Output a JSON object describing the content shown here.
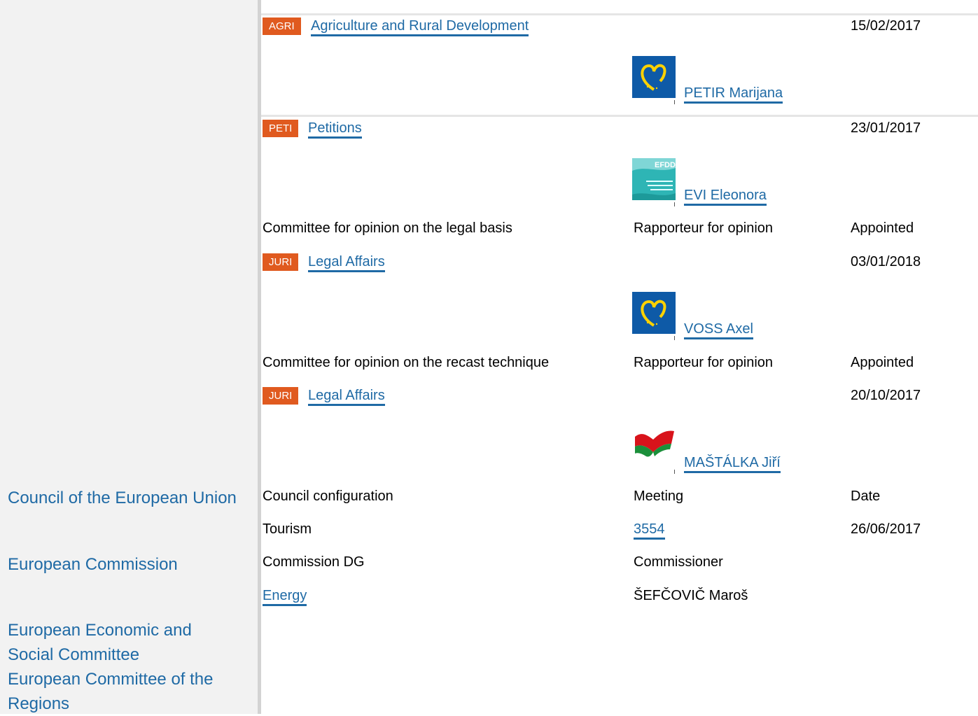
{
  "institutions": {
    "council": "Council of the European Union",
    "commission": "European Commission",
    "eesc": "European Economic and Social Committee",
    "cor": "European Committee of the Regions"
  },
  "committees": [
    {
      "code": "AGRI",
      "name": "Agriculture and Rural Development",
      "date": "15/02/2017",
      "rapporteur": "PETIR Marijana",
      "group_logo": "epp-heart-logo"
    },
    {
      "code": "PETI",
      "name": "Petitions",
      "date": "23/01/2017",
      "rapporteur": "EVI Eleonora",
      "group_logo": "efdd-logo"
    }
  ],
  "legal_basis": {
    "header": {
      "committee": "Committee for opinion on the legal basis",
      "role": "Rapporteur for opinion",
      "status": "Appointed"
    },
    "code": "JURI",
    "name": "Legal Affairs",
    "date": "03/01/2018",
    "rapporteur": "VOSS Axel",
    "group_logo": "epp-heart-logo"
  },
  "recast": {
    "header": {
      "committee": "Committee for opinion on the recast technique",
      "role": "Rapporteur for opinion",
      "status": "Appointed"
    },
    "code": "JURI",
    "name": "Legal Affairs",
    "date": "20/10/2017",
    "rapporteur": "MAŠTÁLKA Jiří",
    "group_logo": "gue-ngl-flag-logo"
  },
  "council": {
    "headers": {
      "configuration": "Council configuration",
      "meeting": "Meeting",
      "date": "Date"
    },
    "configuration": "Tourism",
    "meeting": "3554",
    "date": "26/06/2017"
  },
  "commission": {
    "headers": {
      "dg": "Commission DG",
      "commissioner": "Commissioner"
    },
    "dg": "Energy",
    "commissioner": "ŠEFČOVIČ Maroš"
  },
  "colors": {
    "link": "#1f6aa5",
    "badge": "#e05a1f",
    "sidebar": "#f2f2f2",
    "divider": "#d3d3d3"
  }
}
